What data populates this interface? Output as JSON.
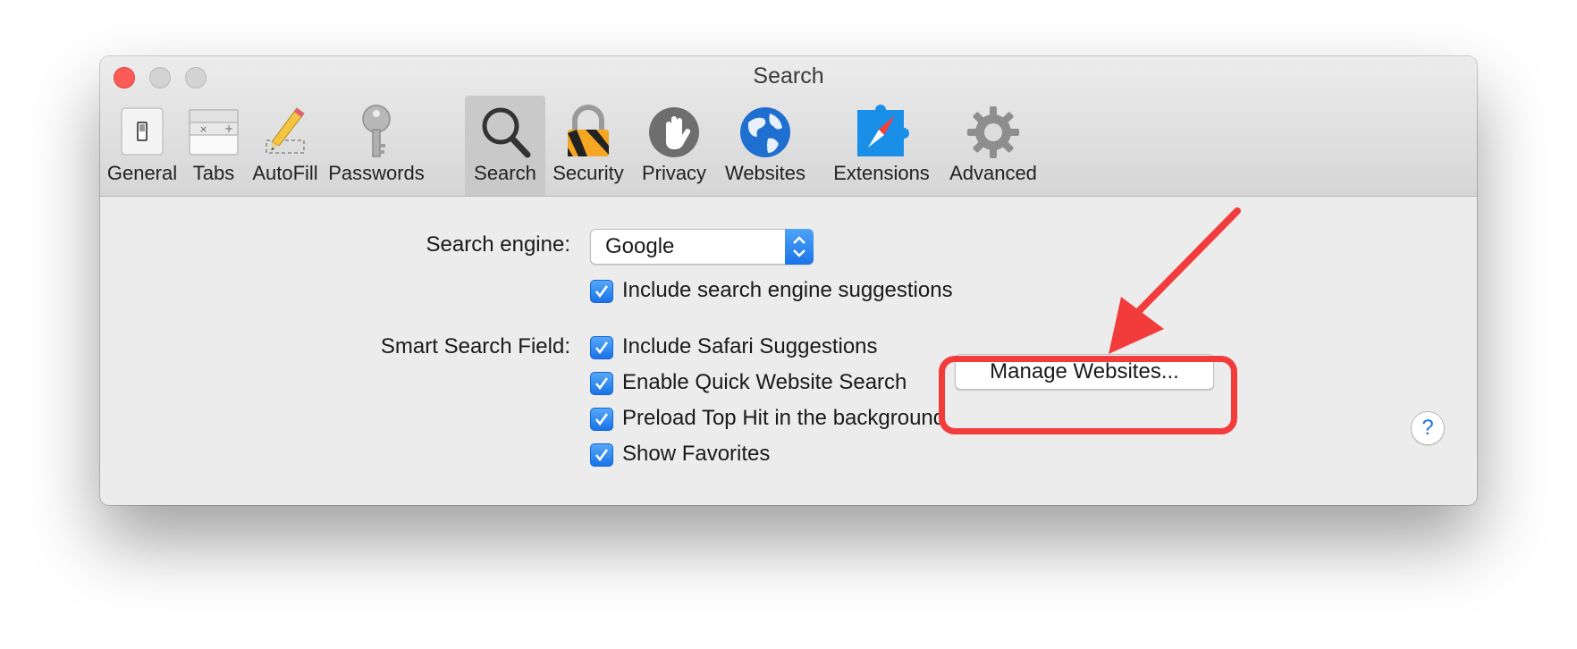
{
  "window": {
    "title": "Search"
  },
  "toolbar": {
    "items": [
      {
        "label": "General",
        "icon": "general-switch-icon"
      },
      {
        "label": "Tabs",
        "icon": "tabs-icon"
      },
      {
        "label": "AutoFill",
        "icon": "pencil-icon"
      },
      {
        "label": "Passwords",
        "icon": "key-icon"
      },
      {
        "label": "Search",
        "icon": "magnifier-icon",
        "selected": true
      },
      {
        "label": "Security",
        "icon": "padlock-icon"
      },
      {
        "label": "Privacy",
        "icon": "hand-icon"
      },
      {
        "label": "Websites",
        "icon": "globe-icon"
      },
      {
        "label": "Extensions",
        "icon": "puzzle-compass-icon"
      },
      {
        "label": "Advanced",
        "icon": "gear-icon"
      }
    ]
  },
  "search": {
    "engine_label": "Search engine:",
    "engine_value": "Google",
    "include_suggestions": "Include search engine suggestions"
  },
  "smart": {
    "label": "Smart Search Field:",
    "options": [
      "Include Safari Suggestions",
      "Enable Quick Website Search",
      "Preload Top Hit in the background",
      "Show Favorites"
    ],
    "manage_button": "Manage Websites..."
  },
  "help": {
    "label": "?"
  },
  "colors": {
    "accent": "#1a73e8",
    "annotation": "#f23c3c",
    "close": "#fc5b57"
  }
}
